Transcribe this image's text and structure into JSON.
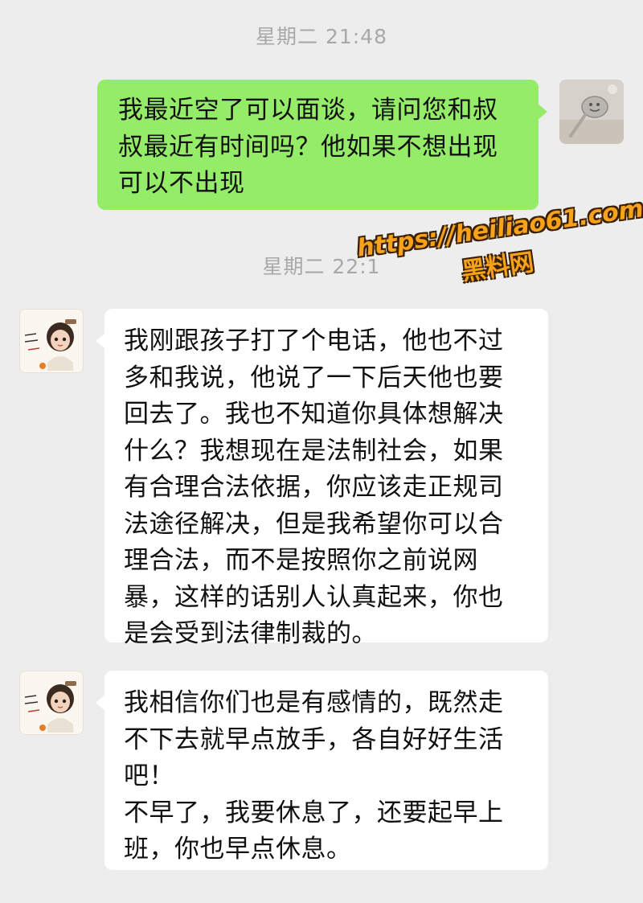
{
  "timestamps": [
    "星期二 21:48",
    "星期二 22:1"
  ],
  "messages": [
    {
      "sender": "self",
      "text": "我最近空了可以面谈，请问您和叔\n叔最近有时间吗？他如果不想出现\n可以不出现"
    },
    {
      "sender": "other",
      "text": "我刚跟孩子打了个电话，他也不过\n多和我说，他说了一下后天他也要\n回去了。我也不知道你具体想解决\n什么？我想现在是法制社会，如果\n有合理合法依据，你应该走正规司\n法途径解决，但是我希望你可以合\n理合法，而不是按照你之前说网\n暴，这样的话别人认真起来，你也\n是会受到法律制裁的。"
    },
    {
      "sender": "other",
      "text": "我相信你们也是有感情的，既然走\n不下去就早点放手，各自好好生活\n吧！\n不早了，我要休息了，还要起早上\n班，你也早点休息。"
    }
  ],
  "watermark": {
    "url": "https://heiliao61.com",
    "name": "黑料网"
  },
  "colors": {
    "background": "#ededed",
    "outgoing_bubble": "#95ec69",
    "incoming_bubble": "#ffffff",
    "timestamp": "#a8a8a8",
    "watermark": "#f6a21a"
  },
  "icons": {
    "self_avatar": "spoon-photo-avatar",
    "other_avatar": "cartoon-girl-avatar"
  }
}
